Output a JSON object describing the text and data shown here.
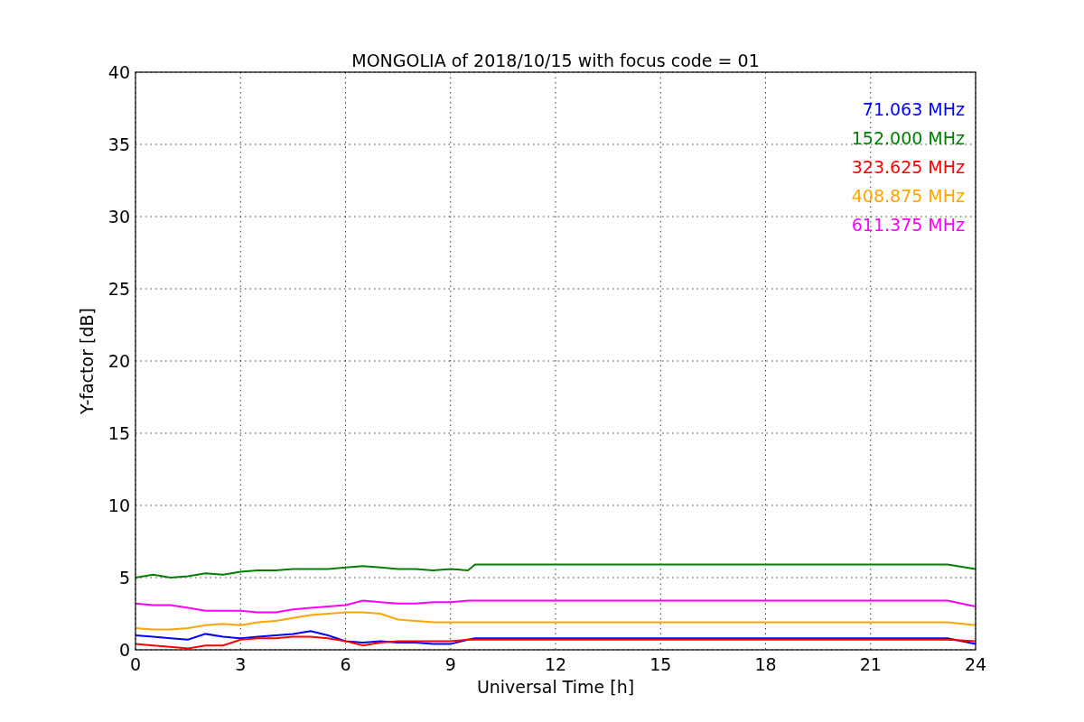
{
  "chart_data": {
    "type": "line",
    "title": "MONGOLIA of 2018/10/15 with focus code = 01",
    "xlabel": "Universal Time [h]",
    "ylabel": "Y-factor [dB]",
    "x": [
      0,
      0.5,
      1,
      1.5,
      2,
      2.5,
      3,
      3.5,
      4,
      4.5,
      5,
      5.5,
      6,
      6.5,
      7,
      7.5,
      8,
      8.5,
      9,
      9.5,
      9.7,
      23.2,
      24
    ],
    "series": [
      {
        "name": "71.063 MHz",
        "color": "#0000ff",
        "values": [
          1.0,
          0.9,
          0.8,
          0.7,
          1.1,
          0.9,
          0.8,
          0.9,
          1.0,
          1.1,
          1.3,
          1.0,
          0.6,
          0.5,
          0.6,
          0.5,
          0.5,
          0.4,
          0.4,
          0.7,
          0.8,
          0.8,
          0.4
        ]
      },
      {
        "name": "152.000 MHz",
        "color": "#008000",
        "values": [
          5.0,
          5.2,
          5.0,
          5.1,
          5.3,
          5.2,
          5.4,
          5.5,
          5.5,
          5.6,
          5.6,
          5.6,
          5.7,
          5.8,
          5.7,
          5.6,
          5.6,
          5.5,
          5.6,
          5.5,
          5.9,
          5.9,
          5.6
        ]
      },
      {
        "name": "323.625 MHz",
        "color": "#ff0000",
        "values": [
          0.4,
          0.3,
          0.2,
          0.1,
          0.3,
          0.3,
          0.7,
          0.8,
          0.8,
          0.9,
          0.9,
          0.8,
          0.6,
          0.3,
          0.5,
          0.6,
          0.6,
          0.6,
          0.6,
          0.7,
          0.7,
          0.7,
          0.6
        ]
      },
      {
        "name": "408.875 MHz",
        "color": "#ffa500",
        "values": [
          1.5,
          1.4,
          1.4,
          1.5,
          1.7,
          1.8,
          1.7,
          1.9,
          2.0,
          2.2,
          2.4,
          2.5,
          2.6,
          2.6,
          2.5,
          2.1,
          2.0,
          1.9,
          1.9,
          1.9,
          1.9,
          1.9,
          1.7
        ]
      },
      {
        "name": "611.375 MHz",
        "color": "#ff00ff",
        "values": [
          3.2,
          3.1,
          3.1,
          2.9,
          2.7,
          2.7,
          2.7,
          2.6,
          2.6,
          2.8,
          2.9,
          3.0,
          3.1,
          3.4,
          3.3,
          3.2,
          3.2,
          3.3,
          3.3,
          3.4,
          3.4,
          3.4,
          3.0
        ]
      }
    ],
    "xlim": [
      0,
      24
    ],
    "ylim": [
      0,
      40
    ],
    "xticks": [
      0,
      3,
      6,
      9,
      12,
      15,
      18,
      21,
      24
    ],
    "yticks": [
      0,
      5,
      10,
      15,
      20,
      25,
      30,
      35,
      40
    ],
    "grid": true
  }
}
